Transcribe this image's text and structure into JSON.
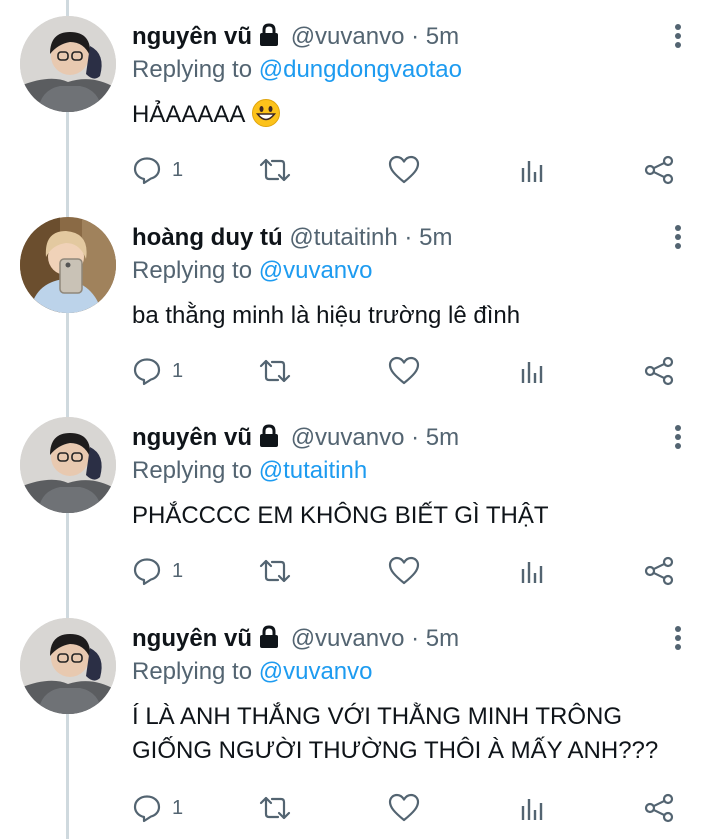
{
  "tweets": [
    {
      "name": "nguyên vũ",
      "handle": "@vuvanvo",
      "dot": "·",
      "time": "5m",
      "replying_prefix": "Replying to",
      "replying_to": "@dungdongvaotao",
      "text_lines": [
        "HẢAAAAA"
      ],
      "emoji": "grinning-face-emoji",
      "reply_count": "1",
      "locked": true,
      "avatar": "avatar-guy-glasses"
    },
    {
      "name": "hoàng duy tú",
      "handle": "@tutaitinh",
      "dot": "·",
      "time": "5m",
      "replying_prefix": "Replying to",
      "replying_to": "@vuvanvo",
      "text_lines": [
        "ba thằng minh là hiệu trường lê đình"
      ],
      "reply_count": "1",
      "locked": false,
      "avatar": "avatar-mirror-selfie"
    },
    {
      "name": "nguyên vũ",
      "handle": "@vuvanvo",
      "dot": "·",
      "time": "5m",
      "replying_prefix": "Replying to",
      "replying_to": "@tutaitinh",
      "text_lines": [
        "PHẮCCCC EM KHÔNG BIẾT GÌ THẬT"
      ],
      "reply_count": "1",
      "locked": true,
      "avatar": "avatar-guy-glasses"
    },
    {
      "name": "nguyên vũ",
      "handle": "@vuvanvo",
      "dot": "·",
      "time": "5m",
      "replying_prefix": "Replying to",
      "replying_to": "@vuvanvo",
      "text_lines": [
        "Í LÀ ANH THẮNG VỚI THẰNG MINH TRÔNG",
        "GIỐNG NGƯỜI THƯỜNG THÔI À MẤY ANH???"
      ],
      "reply_count": "1",
      "locked": true,
      "avatar": "avatar-guy-glasses"
    }
  ],
  "colors": {
    "text": "#0f1419",
    "secondary": "#536471",
    "link": "#1d9bf0",
    "thread_line": "#cfd9de"
  }
}
